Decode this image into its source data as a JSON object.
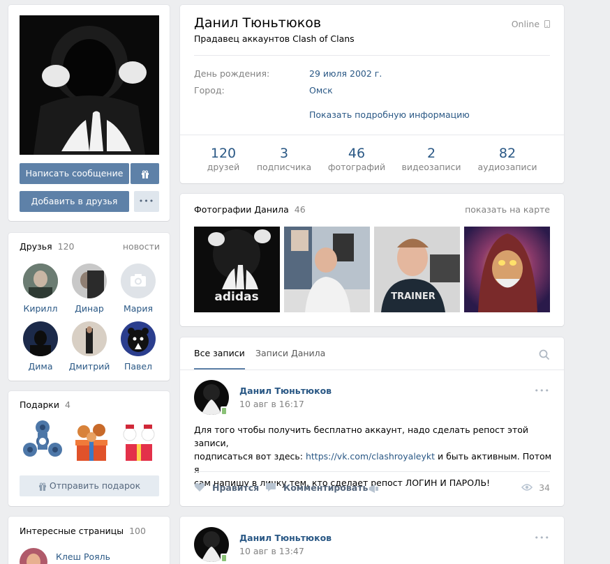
{
  "profile": {
    "name": "Данил Тюньтюков",
    "status": "Прадавец аккаунтов Clash of Clans",
    "online": "Online",
    "birthday_label": "День рождения:",
    "birthday_value": "29 июля 2002 г.",
    "city_label": "Город:",
    "city_value": "Омск",
    "more_info": "Показать подробную информацию"
  },
  "counters": [
    {
      "count": "120",
      "label": "друзей"
    },
    {
      "count": "3",
      "label": "подписчика"
    },
    {
      "count": "46",
      "label": "фотографий"
    },
    {
      "count": "2",
      "label": "видеозаписи"
    },
    {
      "count": "82",
      "label": "аудиозаписи"
    }
  ],
  "actions": {
    "message": "Написать сообщение",
    "add_friend": "Добавить в друзья",
    "more": "•••"
  },
  "friends": {
    "title": "Друзья",
    "count": "120",
    "news": "новости",
    "list": [
      "Кирилл",
      "Динар",
      "Мария",
      "Дима",
      "Дмитрий",
      "Павел"
    ]
  },
  "gifts": {
    "title": "Подарки",
    "count": "4",
    "send": "Отправить подарок"
  },
  "pages": {
    "title": "Интересные страницы",
    "count": "100",
    "first": "Клеш Рояль"
  },
  "photos": {
    "title": "Фотографии Данила",
    "count": "46",
    "map": "показать на карте",
    "adidas_text": "adidas",
    "shirt_text": "TRAINER"
  },
  "wall": {
    "tab_all": "Все записи",
    "tab_own": "Записи Данила",
    "posts": [
      {
        "author": "Данил Тюньтюков",
        "date": "10 авг в 16:17",
        "text_1": "Для того чтобы получить бесплатно аккаунт, надо сделать репост этой записи,",
        "text_2a": "подписаться вот здесь: ",
        "link": "https://vk.com/clashroyaleykt",
        "text_2b": " и быть активным. Потом я",
        "text_3": "сам напишу в личку тем, кто сделает репост ЛОГИН И ПАРОЛЬ!",
        "like": "Нравится",
        "comment": "Комментировать",
        "views": "34"
      },
      {
        "author": "Данил Тюньтюков",
        "date": "10 авг в 13:47"
      }
    ]
  },
  "colors": {
    "accent": "#5e81a8",
    "link": "#2a5885",
    "background": "#edeef0"
  }
}
